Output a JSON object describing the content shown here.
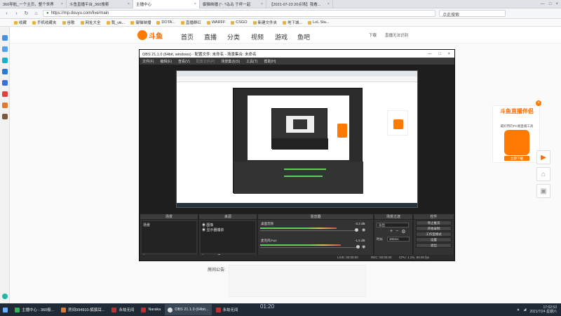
{
  "browser": {
    "tabs": [
      {
        "label": "360导航_一个主页，整个世界"
      },
      {
        "label": "斗鱼直播平台_360搜索"
      },
      {
        "label": "主播中心"
      },
      {
        "label": "御猫映播 (\"- ?ゐゐ 于杯一起"
      },
      {
        "label": "【2021-07-23 20点场】我看..."
      }
    ],
    "url": "https://mp.douyu.com/live/main",
    "search_placeholder": "点此搜索",
    "bookmarks": [
      {
        "label": "收藏"
      },
      {
        "label": "手机收藏夹"
      },
      {
        "label": "谷歌"
      },
      {
        "label": "网址大全"
      },
      {
        "label": "我_vik..."
      },
      {
        "label": "御猫映播"
      },
      {
        "label": "DOTA..."
      },
      {
        "label": "直播群红"
      },
      {
        "label": "WARFF"
      },
      {
        "label": "CSGO"
      },
      {
        "label": "新建文件夹"
      },
      {
        "label": "地下城..."
      },
      {
        "label": "LoL Sta..."
      }
    ]
  },
  "site": {
    "logo": "斗鱼",
    "nav": [
      "首页",
      "直播",
      "分类",
      "视频",
      "游戏",
      "鱼吧"
    ],
    "right_links": [
      "下载",
      "直播无法识别"
    ]
  },
  "obs": {
    "title": "OBS 21.1.0 (64bit, windows) - 配置文件: 未命名 - 场景集合: 未命名",
    "menu": [
      "文件(F)",
      "编辑(E)",
      "查看(V)",
      "配置文件(P)",
      "场景集合(S)",
      "工具(T)",
      "帮助(H)"
    ],
    "docks": {
      "scenes": {
        "title": "场景",
        "items": [
          "场景"
        ]
      },
      "sources": {
        "title": "来源",
        "items": [
          "图像",
          "显示器捕获"
        ]
      },
      "mixer": {
        "title": "混音器",
        "channels": [
          {
            "name": "桌面音频",
            "db": "-3.3 dB",
            "level": 0.78
          },
          {
            "name": "麦克风/Aux",
            "db": "-1.5 dB",
            "level": 0.82
          }
        ]
      },
      "transitions": {
        "title": "场景过渡",
        "type": "淡出",
        "duration_label": "时长",
        "duration": "300ms"
      },
      "controls": {
        "title": "控件",
        "buttons": [
          "停止推流",
          "开始录制",
          "工作室模式",
          "设置",
          "退出"
        ]
      }
    },
    "status": {
      "live": "LIVE: 00:00:00",
      "rec": "REC: 00:00:00",
      "cpu": "CPU: 1.1%, 60.00 fps"
    }
  },
  "promo": {
    "title": "斗鱼直播伴侣",
    "subtitle": "最好用的PC端直播工具",
    "button": "立即下载"
  },
  "chat": {
    "label": "房间公告:"
  },
  "stream_timestamp": "01:20",
  "taskbar": {
    "items": [
      {
        "label": "主播中心 - 360极..."
      },
      {
        "label": "房间994910-狐狐耳..."
      },
      {
        "label": "永劫无间"
      },
      {
        "label": "Naraka"
      },
      {
        "label": "OBS 21.1.0 (64bit..."
      },
      {
        "label": "永劫无间"
      }
    ],
    "clock_time": "17:02:53",
    "clock_date": "2021/7/24 星期六"
  },
  "colors": {
    "brand": "#ff7a00",
    "obs_bg": "#2b2b2b"
  }
}
